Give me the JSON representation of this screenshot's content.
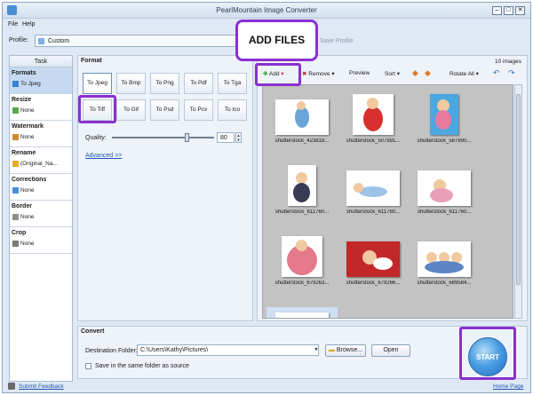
{
  "window": {
    "title": "PearlMountain Image Converter"
  },
  "menu": {
    "file": "File",
    "help": "Help"
  },
  "profile": {
    "label": "Profile:",
    "value": "Custom",
    "ghost": "Save Profile"
  },
  "sidebar": {
    "header": "Task",
    "sections": [
      {
        "name": "Formats",
        "value": "To Jpeg"
      },
      {
        "name": "Resize",
        "value": "None"
      },
      {
        "name": "Watermark",
        "value": "None"
      },
      {
        "name": "Rename",
        "value": "(Original_Na..."
      },
      {
        "name": "Corrections",
        "value": "None"
      },
      {
        "name": "Border",
        "value": "None"
      },
      {
        "name": "Crop",
        "value": "None"
      }
    ]
  },
  "format": {
    "title": "Format",
    "buttons": [
      "To Jpeg",
      "To Bmp",
      "To Png",
      "To Pdf",
      "To Tga",
      "To Tiff",
      "To Gif",
      "To Psd",
      "To Pcx",
      "To Ico"
    ],
    "quality_label": "Quality:",
    "quality_value": "80",
    "advanced": "Advanced >>"
  },
  "callout": {
    "text": "ADD FILES"
  },
  "images": {
    "count": "10 images",
    "toolbar": {
      "add": "Add",
      "remove": "Remove",
      "preview": "Preview",
      "sort": "Sort",
      "rotate": "Rotate All"
    },
    "captions": [
      "shutterstock_423818...",
      "shutterstock_507991...",
      "shutterstock_587890...",
      "shutterstock_611760...",
      "shutterstock_611760...",
      "shutterstock_611760...",
      "shutterstock_679263...",
      "shutterstock_679266...",
      "shutterstock_689584..."
    ]
  },
  "convert": {
    "title": "Convert",
    "dest_label": "Destination Folder:",
    "dest_value": "C:\\Users\\Kathy\\Pictures\\",
    "browse": "Browse...",
    "open": "Open",
    "same_folder": "Save in the same folder as source"
  },
  "start": {
    "label": "START"
  },
  "status": {
    "feedback": "Submit Feedback",
    "home": "Home Page"
  },
  "colors": {
    "highlight": "#8b2fd0",
    "start": "#4a9fe3",
    "panel": "#eef3f9"
  }
}
